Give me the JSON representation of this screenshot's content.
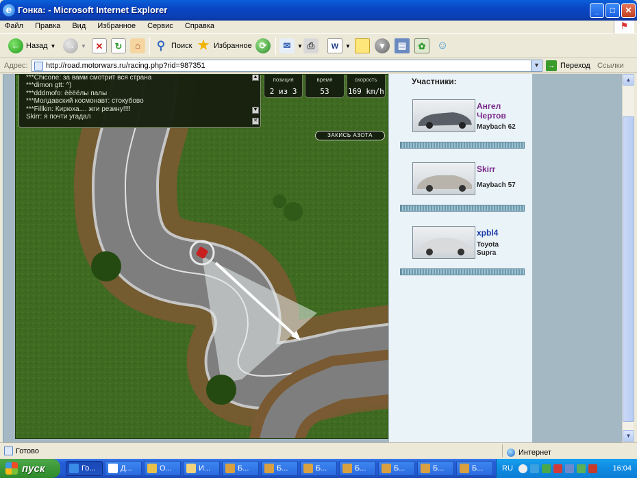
{
  "window": {
    "title": "Гонка: - Microsoft Internet Explorer",
    "controls": {
      "minimize": "_",
      "maximize": "□",
      "close": "✕"
    }
  },
  "menu": [
    "Файл",
    "Правка",
    "Вид",
    "Избранное",
    "Сервис",
    "Справка"
  ],
  "toolbar": {
    "back": "Назад",
    "search": "Поиск",
    "favorites": "Избранное"
  },
  "address": {
    "label": "Адрес:",
    "url": "http://road.motorwars.ru/racing.php?rid=987351",
    "go": "Переход",
    "links": "Ссылки"
  },
  "chat": {
    "lines": [
      "***Chicone: за вами смотрит вся страна",
      "***dimon gtt: ^)",
      "***dddmofo: ëëëëлы палы",
      "***Молдавский космонавт: стокубово",
      "***Fillkin: Кирюха.... жги резину!!!!",
      "Skirr: я почти угадал"
    ]
  },
  "hud": {
    "position_label": "позиция",
    "position_value": "2 из 3",
    "time_label": "время",
    "time_value": "53",
    "speed_label": "скорость",
    "speed_value": "169 km/h"
  },
  "nitro_button": "ЗАКИСЬ АЗОТА",
  "participants": {
    "title": "Участники:",
    "list": [
      {
        "name_line1": "Ангел",
        "name_line2": "Чертов",
        "car_line1": "Maybach 62",
        "car_line2": "",
        "name_color": "#7a2a8a"
      },
      {
        "name_line1": "Skirr",
        "name_line2": "",
        "car_line1": "Maybach 57",
        "car_line2": "",
        "name_color": "#7a2a8a"
      },
      {
        "name_line1": "xpbl4",
        "name_line2": "",
        "car_line1": "Toyota",
        "car_line2": "Supra",
        "name_color": "#1b3aa8"
      }
    ]
  },
  "status": {
    "text": "Готово",
    "zone": "Интернет"
  },
  "taskbar": {
    "start": "пуск",
    "tasks": [
      "Го...",
      "Д...",
      "О...",
      "И...",
      "Б...",
      "Б...",
      "Б...",
      "Б...",
      "Б...",
      "Б...",
      "Б..."
    ],
    "lang": "RU",
    "clock": "16:04"
  }
}
